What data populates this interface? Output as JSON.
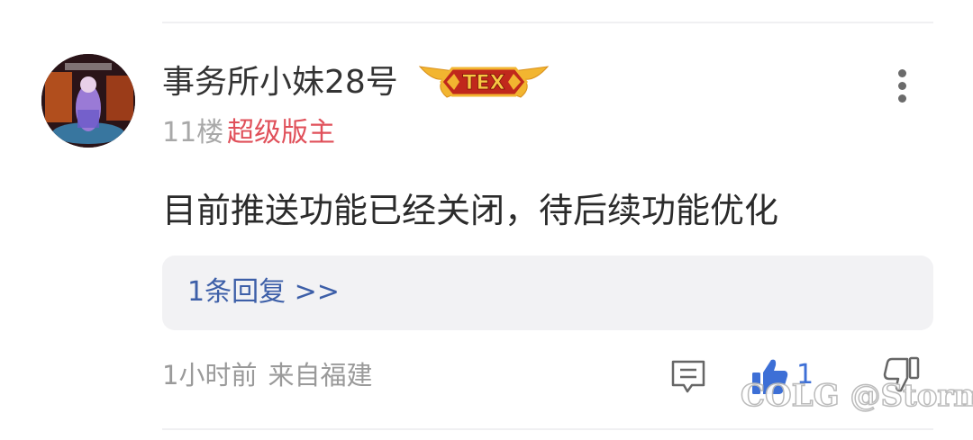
{
  "post": {
    "username": "事务所小妹28号",
    "badge": {
      "text": "TEX",
      "icon": "gold-wing-level-badge"
    },
    "floor": "11楼",
    "role": "超级版主",
    "content": "目前推送功能已经关闭，待后续功能优化",
    "replies_link": "1条回复 >>",
    "time": "1小时前",
    "location": "来自福建",
    "like_count": "1"
  },
  "icons": {
    "more": "more-vertical-icon",
    "comment": "comment-icon",
    "like": "thumbs-up-icon",
    "dislike": "thumbs-down-icon"
  },
  "watermark": "COLG @Stormt",
  "colors": {
    "role": "#e0505a",
    "link": "#3d5fa8",
    "like": "#3d6fd6",
    "badge_red": "#c0281c",
    "badge_gold": "#f2b530"
  }
}
